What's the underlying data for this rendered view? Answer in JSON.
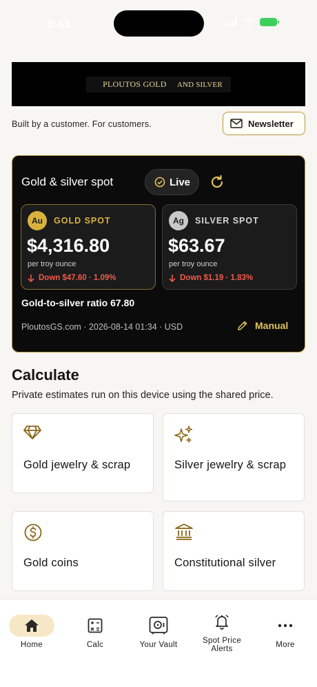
{
  "status_bar": {
    "time": "9:41"
  },
  "banner": {
    "brand_main": "PLOUTOS GOLD",
    "brand_tail": "AND SILVER"
  },
  "tagline": "Built by a customer. For customers.",
  "newsletter_label": "Newsletter",
  "spot": {
    "title": "Gold & silver spot",
    "live_label": "Live",
    "gold": {
      "symbol": "Au",
      "label": "GOLD SPOT",
      "price": "$4,316.80",
      "unit": "per troy ounce",
      "change": "Down $47.60 · 1.09%"
    },
    "silver": {
      "symbol": "Ag",
      "label": "SILVER SPOT",
      "price": "$63.67",
      "unit": "per troy ounce",
      "change": "Down $1.19 · 1.83%"
    },
    "ratio": "Gold-to-silver ratio  67.80",
    "source": "PloutosGS.com · 2026-08-14 01:34 · USD",
    "manual_label": "Manual"
  },
  "calculate": {
    "heading": "Calculate",
    "subtitle": "Private estimates run on this device using the shared price.",
    "tiles": [
      {
        "label": "Gold jewelry & scrap",
        "icon": "diamond-icon"
      },
      {
        "label": "Silver jewelry & scrap",
        "icon": "sparkles-icon"
      },
      {
        "label": "Gold coins",
        "icon": "dollar-coin-icon"
      },
      {
        "label": "Constitutional silver",
        "icon": "bank-icon"
      }
    ]
  },
  "tabs": [
    {
      "label": "Home",
      "icon": "home-icon",
      "active": true
    },
    {
      "label": "Calc",
      "icon": "calculator-icon"
    },
    {
      "label": "Your Vault",
      "icon": "vault-icon"
    },
    {
      "label": "Spot Price Alerts",
      "icon": "bell-icon"
    },
    {
      "label": "More",
      "icon": "more-dots-icon"
    }
  ],
  "colors": {
    "gold_accent": "#d9b23e",
    "down_red": "#ef5a4b",
    "card_bg": "#0b0b0b",
    "active_tab": "#f6e7c6"
  }
}
